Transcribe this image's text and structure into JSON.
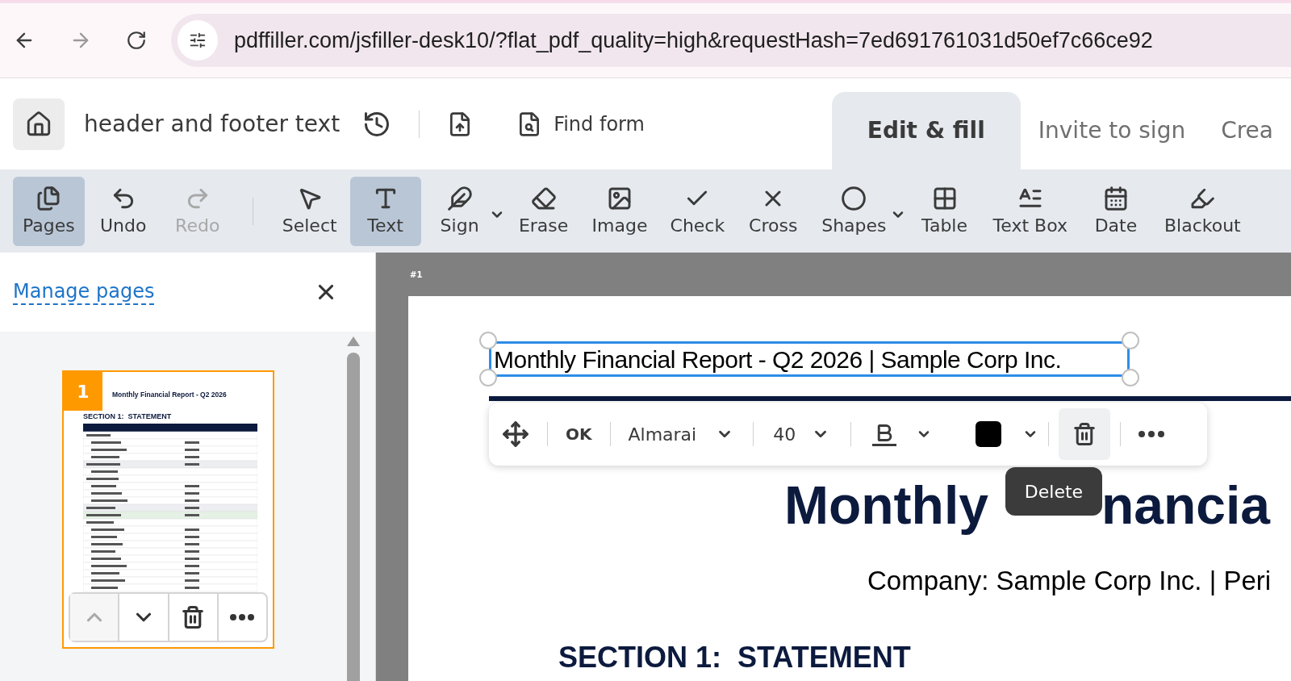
{
  "browser": {
    "url": "pdffiller.com/jsfiller-desk10/?flat_pdf_quality=high&requestHash=7ed691761031d50ef7c66ce92"
  },
  "header": {
    "title": "header and footer text",
    "find_form": "Find form",
    "tabs": [
      {
        "label": "Edit & fill",
        "selected": true
      },
      {
        "label": "Invite to sign",
        "selected": false
      },
      {
        "label": "Crea",
        "selected": false
      }
    ]
  },
  "toolbar": {
    "items": [
      {
        "kind": "pages",
        "label": "Pages",
        "selected": true,
        "disabled": false,
        "dropdown": false
      },
      {
        "kind": "undo",
        "label": "Undo",
        "selected": false,
        "disabled": false,
        "dropdown": false
      },
      {
        "kind": "redo",
        "label": "Redo",
        "selected": false,
        "disabled": true,
        "dropdown": false
      },
      {
        "kind": "divider"
      },
      {
        "kind": "select",
        "label": "Select",
        "selected": false,
        "disabled": false,
        "dropdown": false
      },
      {
        "kind": "text",
        "label": "Text",
        "selected": true,
        "disabled": false,
        "dropdown": false
      },
      {
        "kind": "sign",
        "label": "Sign",
        "selected": false,
        "disabled": false,
        "dropdown": true
      },
      {
        "kind": "erase",
        "label": "Erase",
        "selected": false,
        "disabled": false,
        "dropdown": false
      },
      {
        "kind": "image",
        "label": "Image",
        "selected": false,
        "disabled": false,
        "dropdown": false
      },
      {
        "kind": "check",
        "label": "Check",
        "selected": false,
        "disabled": false,
        "dropdown": false
      },
      {
        "kind": "cross",
        "label": "Cross",
        "selected": false,
        "disabled": false,
        "dropdown": false
      },
      {
        "kind": "shapes",
        "label": "Shapes",
        "selected": false,
        "disabled": false,
        "dropdown": true
      },
      {
        "kind": "table",
        "label": "Table",
        "selected": false,
        "disabled": false,
        "dropdown": false
      },
      {
        "kind": "textbox",
        "label": "Text Box",
        "selected": false,
        "disabled": false,
        "dropdown": false
      },
      {
        "kind": "date",
        "label": "Date",
        "selected": false,
        "disabled": false,
        "dropdown": false
      },
      {
        "kind": "blackout",
        "label": "Blackout",
        "selected": false,
        "disabled": false,
        "dropdown": false
      }
    ]
  },
  "sidebar": {
    "manage_pages": "Manage pages",
    "pages": [
      {
        "number": "1",
        "selected": true,
        "title": "Monthly Financial Report - Q2 2026",
        "section": "SECTION 1:  STATEMENT"
      }
    ],
    "page_actions": [
      {
        "kind": "up",
        "disabled": true
      },
      {
        "kind": "down",
        "disabled": false
      },
      {
        "kind": "delete",
        "disabled": false
      },
      {
        "kind": "more",
        "disabled": false
      }
    ]
  },
  "document": {
    "page_label": "#1",
    "header_text": "Monthly Financial Report - Q2 2026 | Sample Corp Inc.",
    "text_toolbar": {
      "ok": "OK",
      "font": "Almarai",
      "size": "40",
      "color": "#000000"
    },
    "tooltip": "Delete",
    "heading_parts": [
      "Monthly",
      "nancia"
    ],
    "subheading": "Company: Sample Corp Inc. | Peri",
    "section": "SECTION 1:  STATEMENT"
  }
}
